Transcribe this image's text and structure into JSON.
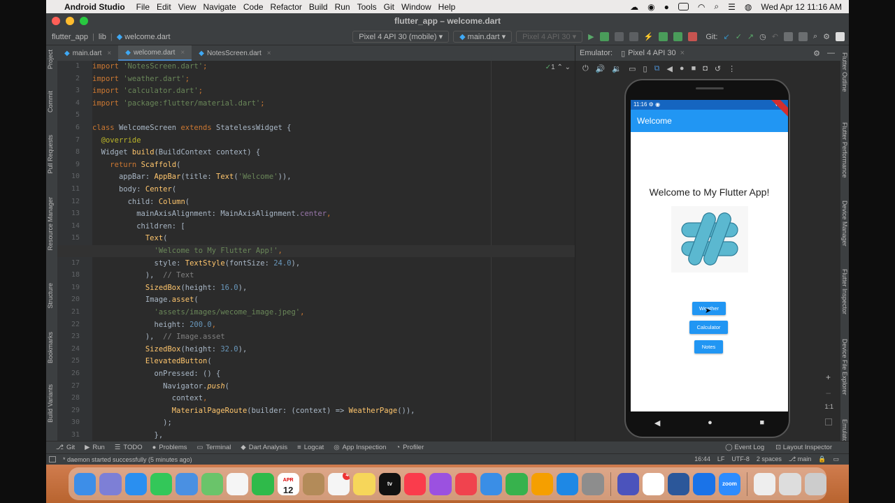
{
  "menubar": {
    "app_name": "Android Studio",
    "items": [
      "File",
      "Edit",
      "View",
      "Navigate",
      "Code",
      "Refactor",
      "Build",
      "Run",
      "Tools",
      "Git",
      "Window",
      "Help"
    ],
    "datetime": "Wed Apr 12  11:16 AM"
  },
  "window": {
    "title": "flutter_app – welcome.dart"
  },
  "navbar": {
    "project": "flutter_app",
    "folder": "lib",
    "file": "welcome.dart",
    "device_select": "Pixel 4 API 30 (mobile)",
    "config_select": "main.dart",
    "device_select_2": "Pixel 4 API 30",
    "git_label": "Git:"
  },
  "editor_tabs": [
    {
      "label": "main.dart"
    },
    {
      "label": "welcome.dart"
    },
    {
      "label": "NotesScreen.dart"
    }
  ],
  "editor_status": "1",
  "left_strip": [
    "Project",
    "Commit",
    "Pull Requests",
    "Resource Manager",
    "Structure",
    "Bookmarks",
    "Build Variants"
  ],
  "right_strip": [
    "Flutter Outline",
    "Flutter Performance",
    "Device Manager",
    "Flutter Inspector",
    "Device File Explorer",
    "Emulator"
  ],
  "emulator": {
    "label": "Emulator:",
    "device_tab": "Pixel 4 API 30",
    "zoom_ratio": "1:1",
    "phone": {
      "time": "11:16",
      "app_title": "Welcome",
      "heading": "Welcome to My Flutter App!",
      "buttons": [
        "Weather",
        "Calculator",
        "Notes"
      ]
    }
  },
  "toolwindows": [
    {
      "label": "Git",
      "icon": "git-icon"
    },
    {
      "label": "Run",
      "icon": "run-icon"
    },
    {
      "label": "TODO",
      "icon": "todo-icon"
    },
    {
      "label": "Problems",
      "icon": "problems-icon"
    },
    {
      "label": "Terminal",
      "icon": "terminal-icon"
    },
    {
      "label": "Dart Analysis",
      "icon": "dart-icon"
    },
    {
      "label": "Logcat",
      "icon": "logcat-icon"
    },
    {
      "label": "App Inspection",
      "icon": "inspection-icon"
    },
    {
      "label": "Profiler",
      "icon": "profiler-icon"
    }
  ],
  "toolwindows_right": [
    "Event Log",
    "Layout Inspector"
  ],
  "statusline": {
    "message": "* daemon started successfully (5 minutes ago)",
    "position": "16:44",
    "line_sep": "LF",
    "encoding": "UTF-8",
    "indent": "2 spaces",
    "branch": "main"
  },
  "dock": {
    "calendar_month": "APR",
    "calendar_day": "12",
    "badge": "4",
    "tv_label": "tv",
    "zoom_label": "zoom"
  }
}
